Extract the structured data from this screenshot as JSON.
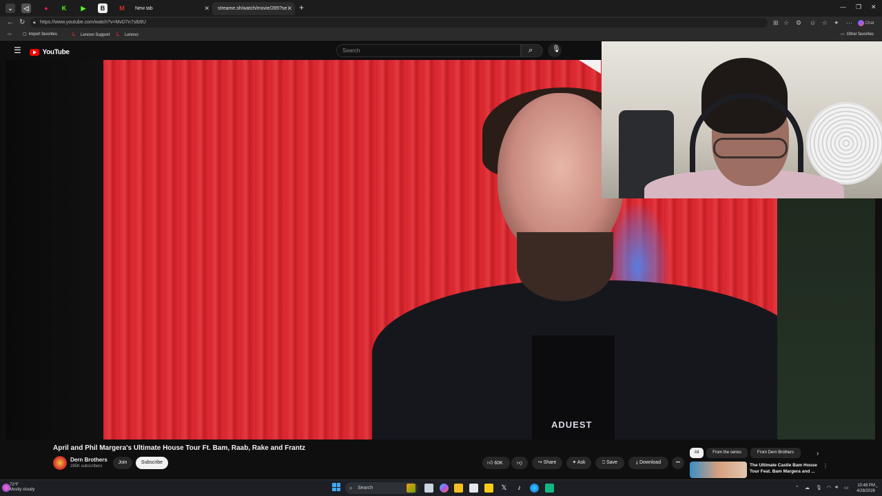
{
  "browser": {
    "tabs": [
      {
        "label": "New tab"
      },
      {
        "label": "streame.sh/watch/movie/285?se"
      }
    ],
    "new_tab": "+",
    "tab_close": "✕",
    "url": "https://www.youtube.com/watch?v=MvD7n7sIb9U",
    "favorites": {
      "import": "Import favorites",
      "lenovo_support": "Lenovo Support",
      "lenovo": "Lenovo",
      "other": "Other favorites",
      "lenovo_letter": "L"
    },
    "chat": "Chat",
    "window_controls": {
      "min": "—",
      "max": "❐",
      "close": "✕"
    }
  },
  "youtube": {
    "logo": "YouTube",
    "search_placeholder": "Search",
    "video": {
      "title": "April and Phil Margera's Ultimate House Tour Ft. Bam, Raab, Rake and Frantz",
      "channel": "Dern Brothers",
      "subscribers": "285K subscribers",
      "join": "Join",
      "subscribe": "Subscribe",
      "likes": "60K",
      "share": "Share",
      "ask": "Ask",
      "save": "Save",
      "download": "Download",
      "more": "•••",
      "shirt_text": "ADUEST"
    },
    "chips": [
      "All",
      "From the series",
      "From Dern Brothers"
    ],
    "recommended": {
      "title": "The Ultimate Castle Bam House Tour Feat. Bam Margera and ..."
    }
  },
  "taskbar": {
    "weather_temp": "72°F",
    "weather_desc": "Mostly cloudy",
    "search": "Search",
    "time": "10:48 PM",
    "date": "4/28/2026"
  },
  "colors": {
    "youtube_red": "#ff0000",
    "background": "#0f0f0f",
    "wall_red": "#d8242d"
  }
}
